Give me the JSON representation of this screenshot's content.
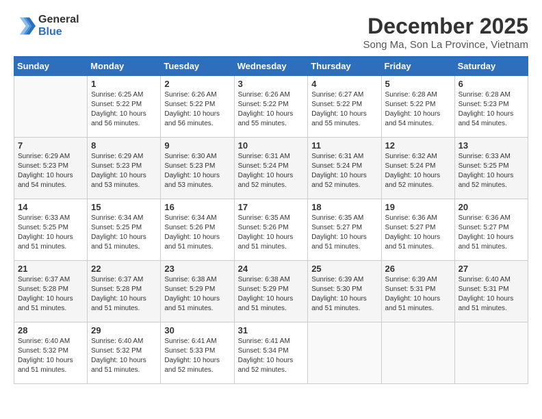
{
  "logo": {
    "general": "General",
    "blue": "Blue"
  },
  "title": "December 2025",
  "subtitle": "Song Ma, Son La Province, Vietnam",
  "weekdays": [
    "Sunday",
    "Monday",
    "Tuesday",
    "Wednesday",
    "Thursday",
    "Friday",
    "Saturday"
  ],
  "weeks": [
    [
      {
        "day": "",
        "info": ""
      },
      {
        "day": "1",
        "info": "Sunrise: 6:25 AM\nSunset: 5:22 PM\nDaylight: 10 hours\nand 56 minutes."
      },
      {
        "day": "2",
        "info": "Sunrise: 6:26 AM\nSunset: 5:22 PM\nDaylight: 10 hours\nand 56 minutes."
      },
      {
        "day": "3",
        "info": "Sunrise: 6:26 AM\nSunset: 5:22 PM\nDaylight: 10 hours\nand 55 minutes."
      },
      {
        "day": "4",
        "info": "Sunrise: 6:27 AM\nSunset: 5:22 PM\nDaylight: 10 hours\nand 55 minutes."
      },
      {
        "day": "5",
        "info": "Sunrise: 6:28 AM\nSunset: 5:22 PM\nDaylight: 10 hours\nand 54 minutes."
      },
      {
        "day": "6",
        "info": "Sunrise: 6:28 AM\nSunset: 5:23 PM\nDaylight: 10 hours\nand 54 minutes."
      }
    ],
    [
      {
        "day": "7",
        "info": "Sunrise: 6:29 AM\nSunset: 5:23 PM\nDaylight: 10 hours\nand 54 minutes."
      },
      {
        "day": "8",
        "info": "Sunrise: 6:29 AM\nSunset: 5:23 PM\nDaylight: 10 hours\nand 53 minutes."
      },
      {
        "day": "9",
        "info": "Sunrise: 6:30 AM\nSunset: 5:23 PM\nDaylight: 10 hours\nand 53 minutes."
      },
      {
        "day": "10",
        "info": "Sunrise: 6:31 AM\nSunset: 5:24 PM\nDaylight: 10 hours\nand 52 minutes."
      },
      {
        "day": "11",
        "info": "Sunrise: 6:31 AM\nSunset: 5:24 PM\nDaylight: 10 hours\nand 52 minutes."
      },
      {
        "day": "12",
        "info": "Sunrise: 6:32 AM\nSunset: 5:24 PM\nDaylight: 10 hours\nand 52 minutes."
      },
      {
        "day": "13",
        "info": "Sunrise: 6:33 AM\nSunset: 5:25 PM\nDaylight: 10 hours\nand 52 minutes."
      }
    ],
    [
      {
        "day": "14",
        "info": "Sunrise: 6:33 AM\nSunset: 5:25 PM\nDaylight: 10 hours\nand 51 minutes."
      },
      {
        "day": "15",
        "info": "Sunrise: 6:34 AM\nSunset: 5:25 PM\nDaylight: 10 hours\nand 51 minutes."
      },
      {
        "day": "16",
        "info": "Sunrise: 6:34 AM\nSunset: 5:26 PM\nDaylight: 10 hours\nand 51 minutes."
      },
      {
        "day": "17",
        "info": "Sunrise: 6:35 AM\nSunset: 5:26 PM\nDaylight: 10 hours\nand 51 minutes."
      },
      {
        "day": "18",
        "info": "Sunrise: 6:35 AM\nSunset: 5:27 PM\nDaylight: 10 hours\nand 51 minutes."
      },
      {
        "day": "19",
        "info": "Sunrise: 6:36 AM\nSunset: 5:27 PM\nDaylight: 10 hours\nand 51 minutes."
      },
      {
        "day": "20",
        "info": "Sunrise: 6:36 AM\nSunset: 5:27 PM\nDaylight: 10 hours\nand 51 minutes."
      }
    ],
    [
      {
        "day": "21",
        "info": "Sunrise: 6:37 AM\nSunset: 5:28 PM\nDaylight: 10 hours\nand 51 minutes."
      },
      {
        "day": "22",
        "info": "Sunrise: 6:37 AM\nSunset: 5:28 PM\nDaylight: 10 hours\nand 51 minutes."
      },
      {
        "day": "23",
        "info": "Sunrise: 6:38 AM\nSunset: 5:29 PM\nDaylight: 10 hours\nand 51 minutes."
      },
      {
        "day": "24",
        "info": "Sunrise: 6:38 AM\nSunset: 5:29 PM\nDaylight: 10 hours\nand 51 minutes."
      },
      {
        "day": "25",
        "info": "Sunrise: 6:39 AM\nSunset: 5:30 PM\nDaylight: 10 hours\nand 51 minutes."
      },
      {
        "day": "26",
        "info": "Sunrise: 6:39 AM\nSunset: 5:31 PM\nDaylight: 10 hours\nand 51 minutes."
      },
      {
        "day": "27",
        "info": "Sunrise: 6:40 AM\nSunset: 5:31 PM\nDaylight: 10 hours\nand 51 minutes."
      }
    ],
    [
      {
        "day": "28",
        "info": "Sunrise: 6:40 AM\nSunset: 5:32 PM\nDaylight: 10 hours\nand 51 minutes."
      },
      {
        "day": "29",
        "info": "Sunrise: 6:40 AM\nSunset: 5:32 PM\nDaylight: 10 hours\nand 51 minutes."
      },
      {
        "day": "30",
        "info": "Sunrise: 6:41 AM\nSunset: 5:33 PM\nDaylight: 10 hours\nand 52 minutes."
      },
      {
        "day": "31",
        "info": "Sunrise: 6:41 AM\nSunset: 5:34 PM\nDaylight: 10 hours\nand 52 minutes."
      },
      {
        "day": "",
        "info": ""
      },
      {
        "day": "",
        "info": ""
      },
      {
        "day": "",
        "info": ""
      }
    ]
  ]
}
